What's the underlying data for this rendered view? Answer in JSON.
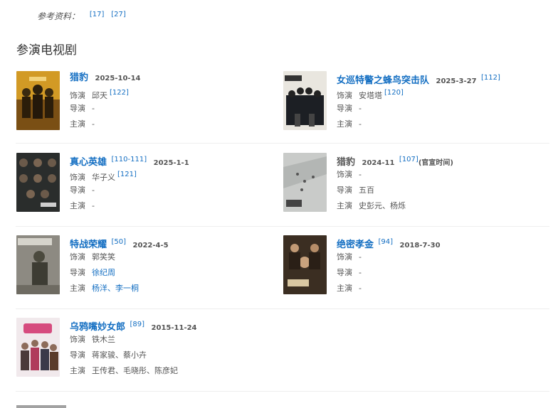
{
  "references": {
    "label": "参考资料：",
    "sups": [
      "[17]",
      "[27]"
    ]
  },
  "section": {
    "title": "参演电视剧"
  },
  "labels": {
    "role": "饰演",
    "director": "导演",
    "cast": "主演"
  },
  "items": [
    {
      "title": "猎豹",
      "date": "2025-10-14",
      "sup": "[122]",
      "note": "",
      "role": "邱天",
      "role_sup": "[122]",
      "director": "-",
      "cast": "-"
    },
    {
      "title": "女巡特警之蜂鸟突击队",
      "date": "2025-3-27",
      "sup": "[112]",
      "note": "",
      "role": "安塔塔",
      "role_sup": "[120]",
      "director": "-",
      "cast": "-"
    },
    {
      "title": "真心英雄",
      "date": "2025-1-1",
      "sup": "[110-111]",
      "note": "",
      "role": "华子义",
      "role_sup": "[121]",
      "director": "-",
      "cast": "-"
    },
    {
      "title": "猎豹",
      "date": "2024-11",
      "sup": "[107]",
      "note": "(官宣时间)",
      "role": "-",
      "role_sup": "",
      "director": "五百",
      "cast": "史彭元、杨烁"
    },
    {
      "title": "特战荣耀",
      "date": "2022-4-5",
      "sup": "[50]",
      "note": "",
      "role": "郭笑笑",
      "role_sup": "",
      "director": "徐纪周",
      "cast": "杨洋、李一桐"
    },
    {
      "title": "绝密孝金",
      "date": "2018-7-30",
      "sup": "[94]",
      "note": "",
      "role": "-",
      "role_sup": "",
      "director": "-",
      "cast": "-"
    },
    {
      "title": "乌鸦嘴妙女郎",
      "date": "2015-11-24",
      "sup": "[89]",
      "note": "",
      "role": "铁木兰",
      "role_sup": "",
      "director": "蒋家骏、蔡小卉",
      "cast": "王传君、毛晓彤、陈彦妃"
    }
  ],
  "colors": {
    "link": "#136ec2",
    "text": "#555555",
    "divider": "#eeeeee"
  }
}
